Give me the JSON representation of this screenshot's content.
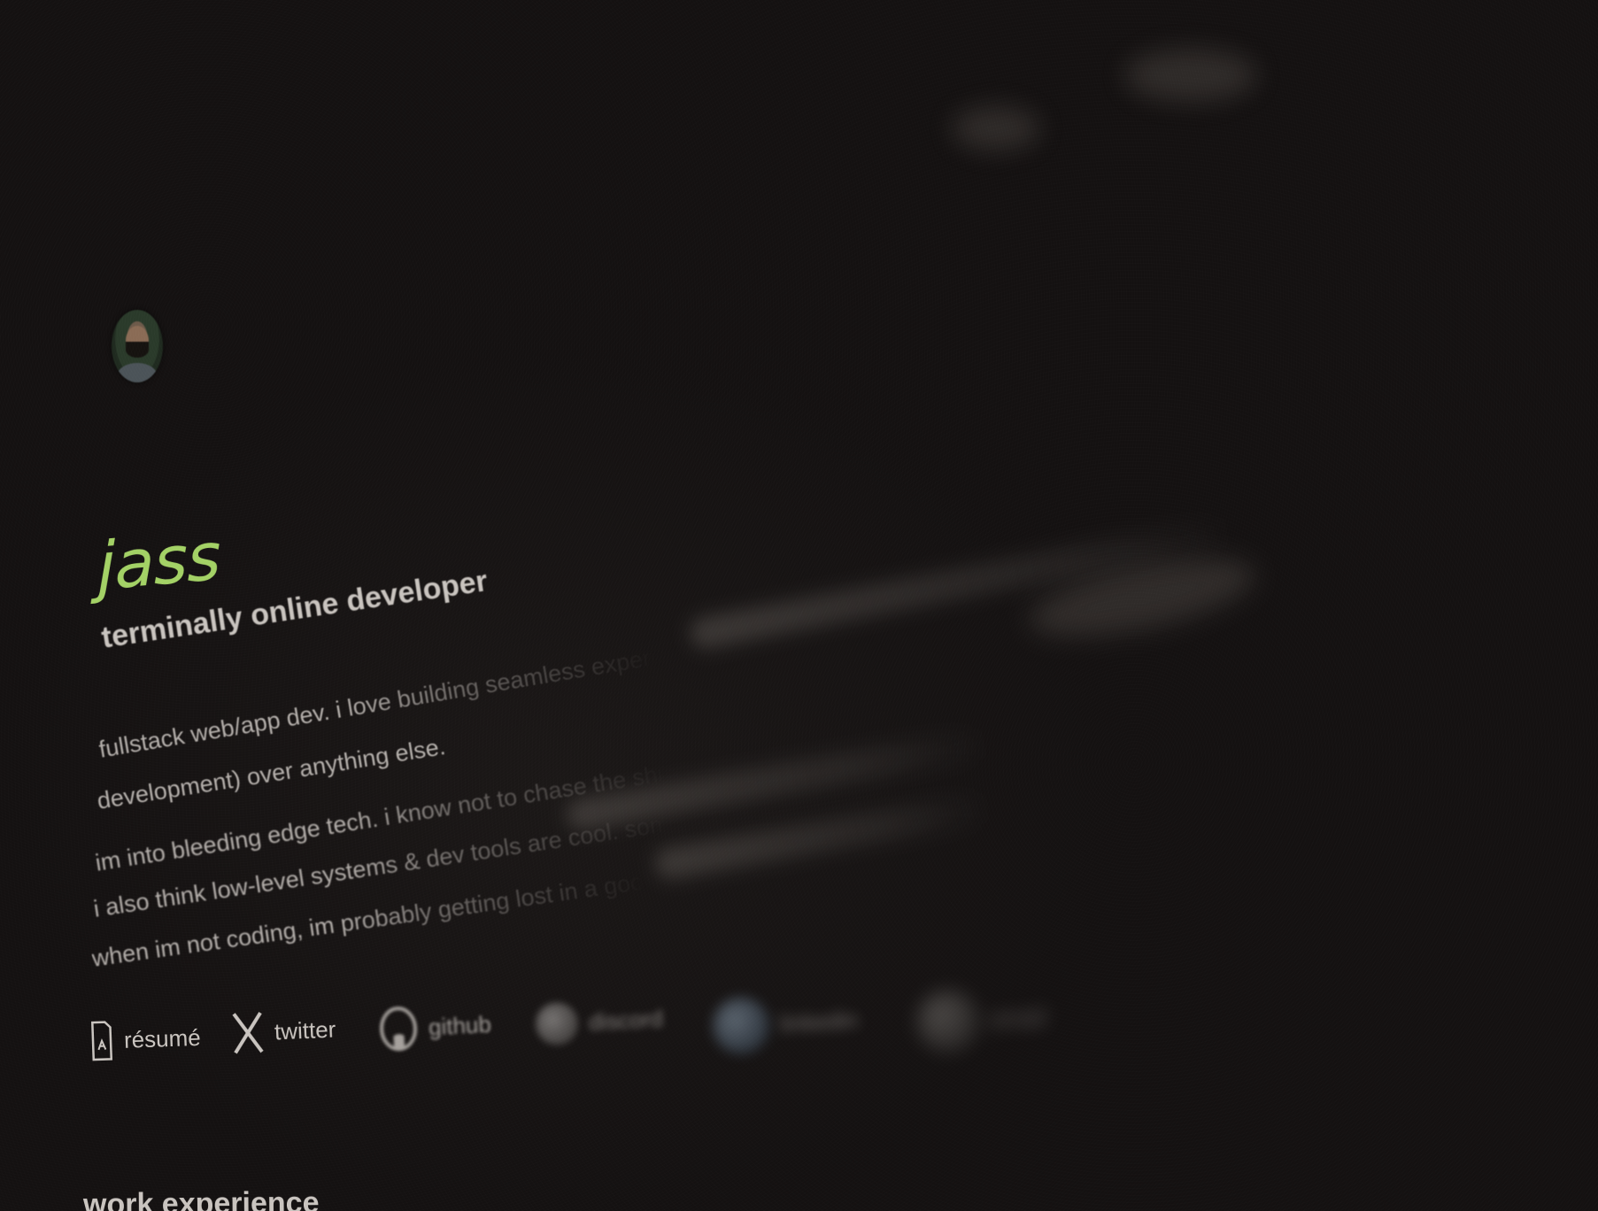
{
  "profile": {
    "name": "jass",
    "tagline": "terminally online developer",
    "avatar_alt": "avatar"
  },
  "bio": {
    "line1": "fullstack web/app dev. i love building seamless experiences (",
    "line2": "development) over anything else.",
    "line3": "im into bleeding edge tech. i know not to chase the shiny thing",
    "line4": "i also think low-level systems & dev tools are cool. somewhere",
    "line5": "when im not coding, im probably getting lost in a good game"
  },
  "links": {
    "resume_label": "résumé",
    "twitter_label": "twitter",
    "github_label": "github",
    "discord_label": "discord",
    "linkedin_label": "linkedin",
    "email_label": "email"
  },
  "sections": {
    "work_title": "work experience"
  },
  "colors": {
    "background": "#141111",
    "accent_name": "#a3d165",
    "text": "#c9c4bf"
  },
  "icons": {
    "resume": "document-icon",
    "twitter": "x-logo-icon",
    "github": "github-icon",
    "discord": "discord-icon",
    "linkedin": "linkedin-icon",
    "email": "email-icon"
  }
}
